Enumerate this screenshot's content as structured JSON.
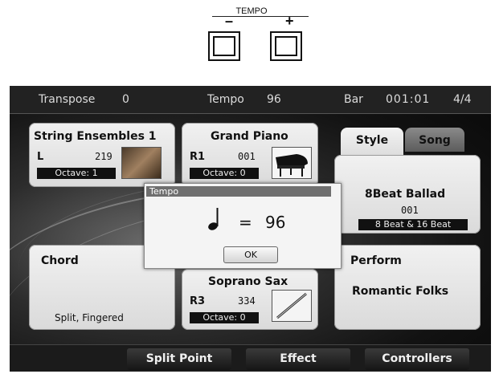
{
  "tempo_diagram": {
    "title": "TEMPO",
    "minus": "–",
    "plus": "+"
  },
  "status_bar": {
    "transpose_label": "Transpose",
    "transpose_value": "0",
    "tempo_label": "Tempo",
    "tempo_value": "96",
    "bar_label": "Bar",
    "bar_value": "001:01",
    "time_signature": "4/4"
  },
  "voices": {
    "l": {
      "name": "String Ensembles 1",
      "part": "L",
      "number": "219",
      "octave": "Octave:  1",
      "image": "violin-icon"
    },
    "r1": {
      "name": "Grand Piano",
      "part": "R1",
      "number": "001",
      "octave": "Octave:  0",
      "image": "grand-piano-icon"
    },
    "r3": {
      "name": "Soprano Sax",
      "part": "R3",
      "number": "334",
      "octave": "Octave:  0",
      "image": "saxophone-icon"
    }
  },
  "chord_panel": {
    "title": "Chord",
    "mode": "Split, Fingered"
  },
  "style_panel": {
    "tabs": [
      "Style",
      "Song"
    ],
    "name": "8Beat Ballad",
    "number": "001",
    "category": "8 Beat & 16 Beat"
  },
  "perform_panel": {
    "title": "Perform",
    "name": "Romantic Folks"
  },
  "dialog": {
    "title": "Tempo",
    "equals": "=",
    "value": "96",
    "ok": "OK",
    "note_icon": "quarter-note-icon"
  },
  "bottom_bar": {
    "buttons": [
      "Split Point",
      "Effect",
      "Controllers"
    ]
  },
  "colors": {
    "screen_bg": "#1a1a1a",
    "panel_bg": "#e6e6e6",
    "dialog_title": "#6f6f6f"
  }
}
